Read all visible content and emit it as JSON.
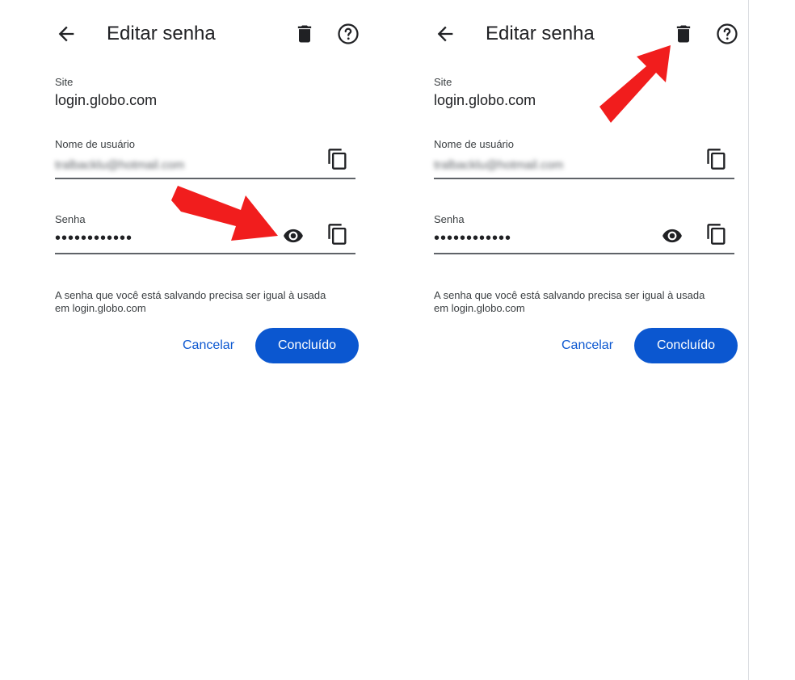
{
  "panels": [
    {
      "title": "Editar senha",
      "site_label": "Site",
      "site_value": "login.globo.com",
      "username_label": "Nome de usuário",
      "username_value": "tralbacklu@hotmail.com",
      "password_label": "Senha",
      "password_value": "••••••••••••",
      "note_line1": "A senha que você está salvando precisa ser igual à usada",
      "note_line2": "em login.globo.com",
      "cancel_label": "Cancelar",
      "done_label": "Concluído"
    },
    {
      "title": "Editar senha",
      "site_label": "Site",
      "site_value": "login.globo.com",
      "username_label": "Nome de usuário",
      "username_value": "tralbacklu@hotmail.com",
      "password_label": "Senha",
      "password_value": "••••••••••••",
      "note_line1": "A senha que você está salvando precisa ser igual à usada",
      "note_line2": "em login.globo.com",
      "cancel_label": "Cancelar",
      "done_label": "Concluído"
    }
  ],
  "icons": {
    "back": "arrow-back-icon",
    "delete": "trash-icon",
    "help": "help-circle-icon",
    "copy": "copy-icon",
    "show_password": "eye-icon",
    "annotation": "red-arrow-icon"
  },
  "colors": {
    "primary": "#0b57d0",
    "text": "#202124",
    "secondary_text": "#3c4043",
    "annotation_arrow": "#f11d1d"
  }
}
